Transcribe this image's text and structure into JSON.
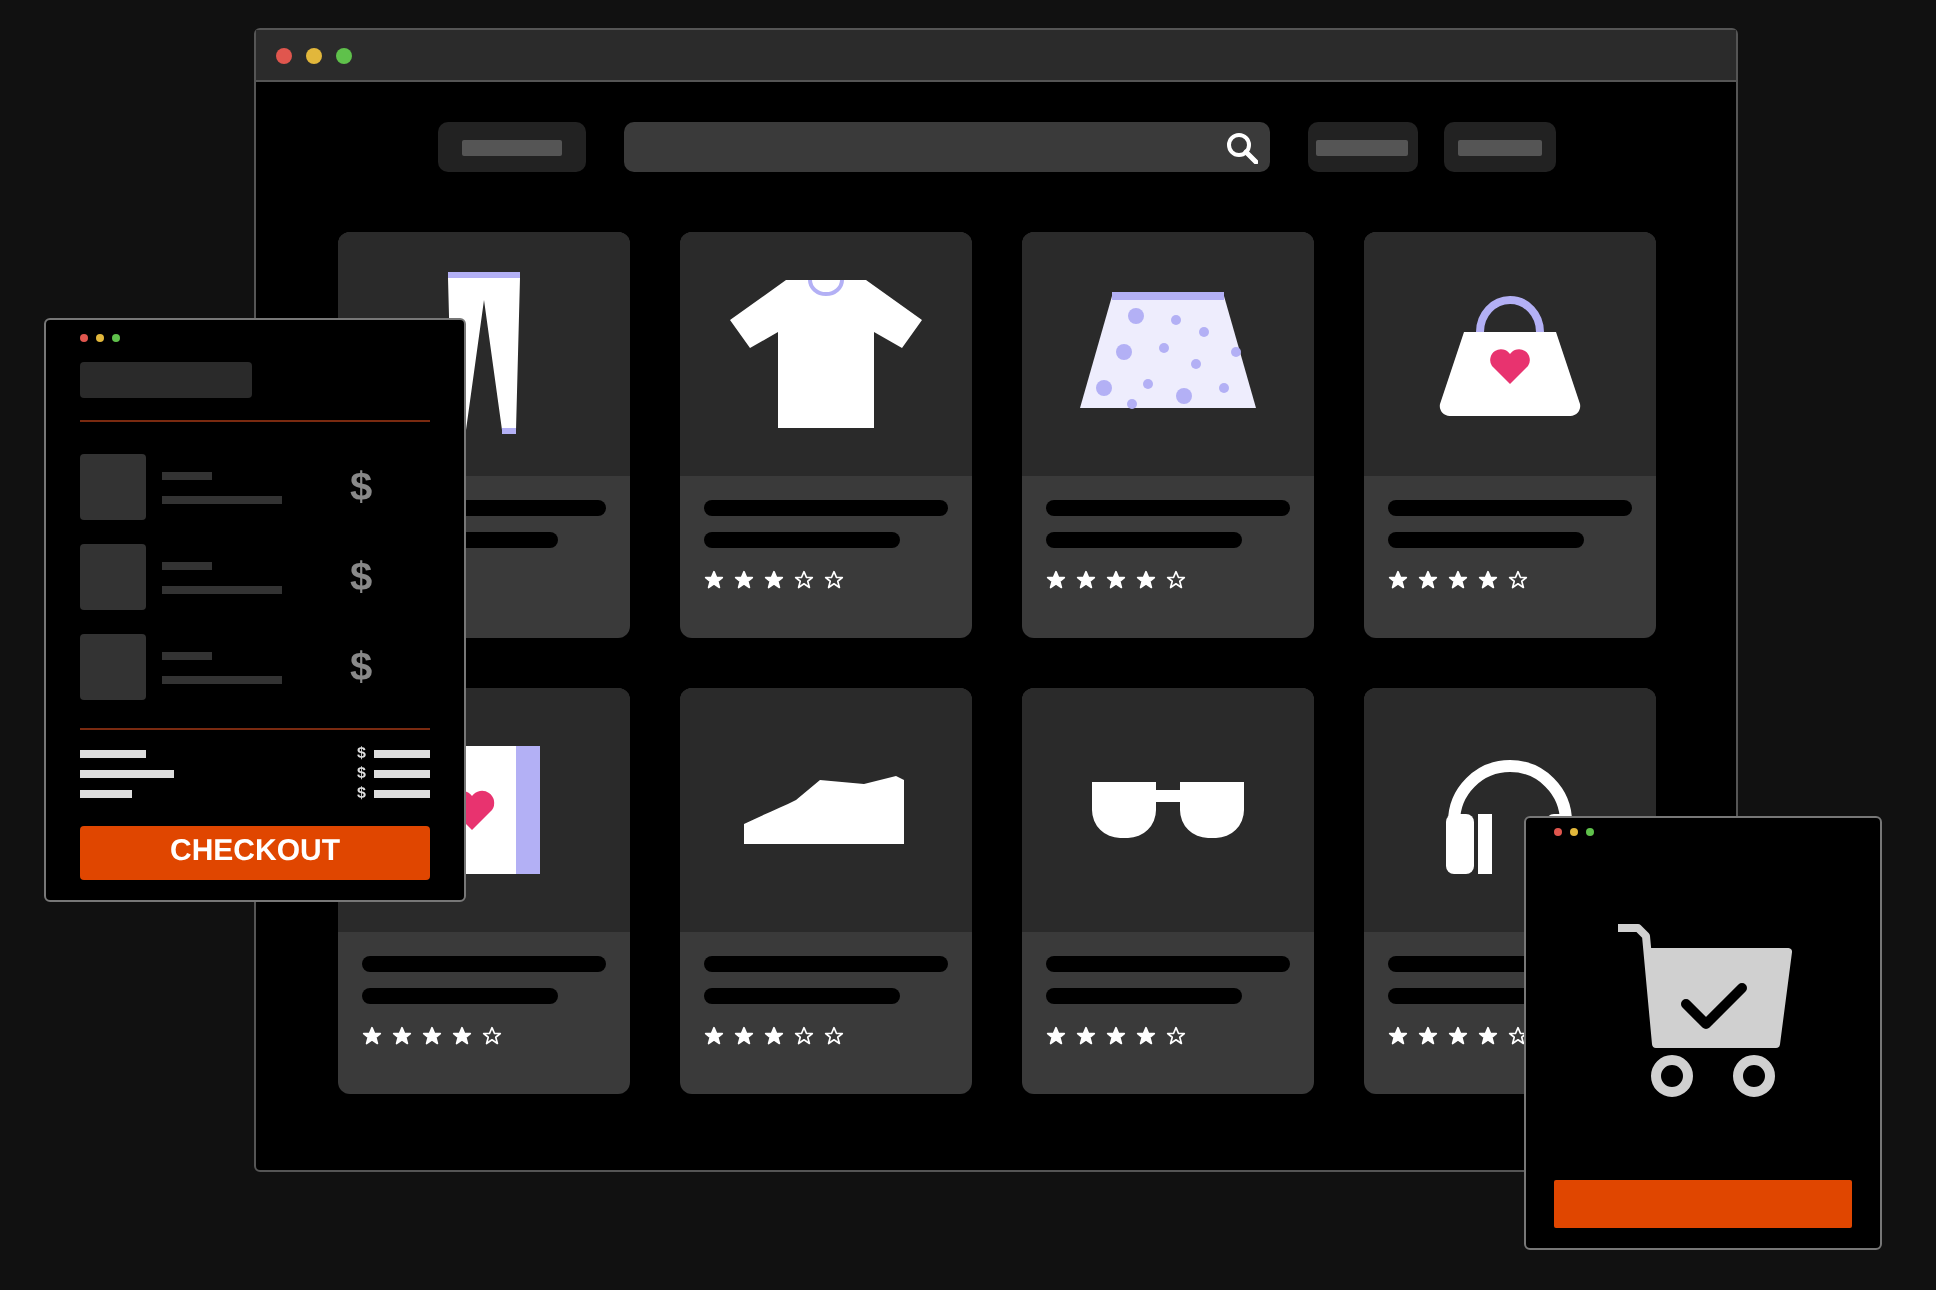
{
  "store": {
    "products": [
      {
        "kind": "covered"
      },
      {
        "stars": 3
      },
      {
        "stars": 4
      },
      {
        "stars": 4
      },
      {
        "stars": 4
      },
      {
        "stars": 3
      },
      {
        "stars": 4
      },
      {
        "stars": 4
      }
    ]
  },
  "cart_panel": {
    "items": [
      {
        "price": "$"
      },
      {
        "price": "$"
      },
      {
        "price": "$"
      }
    ],
    "summary": [
      {
        "currency": "$"
      },
      {
        "currency": "$"
      },
      {
        "currency": "$"
      }
    ],
    "checkout_button": "CHECKOUT"
  }
}
